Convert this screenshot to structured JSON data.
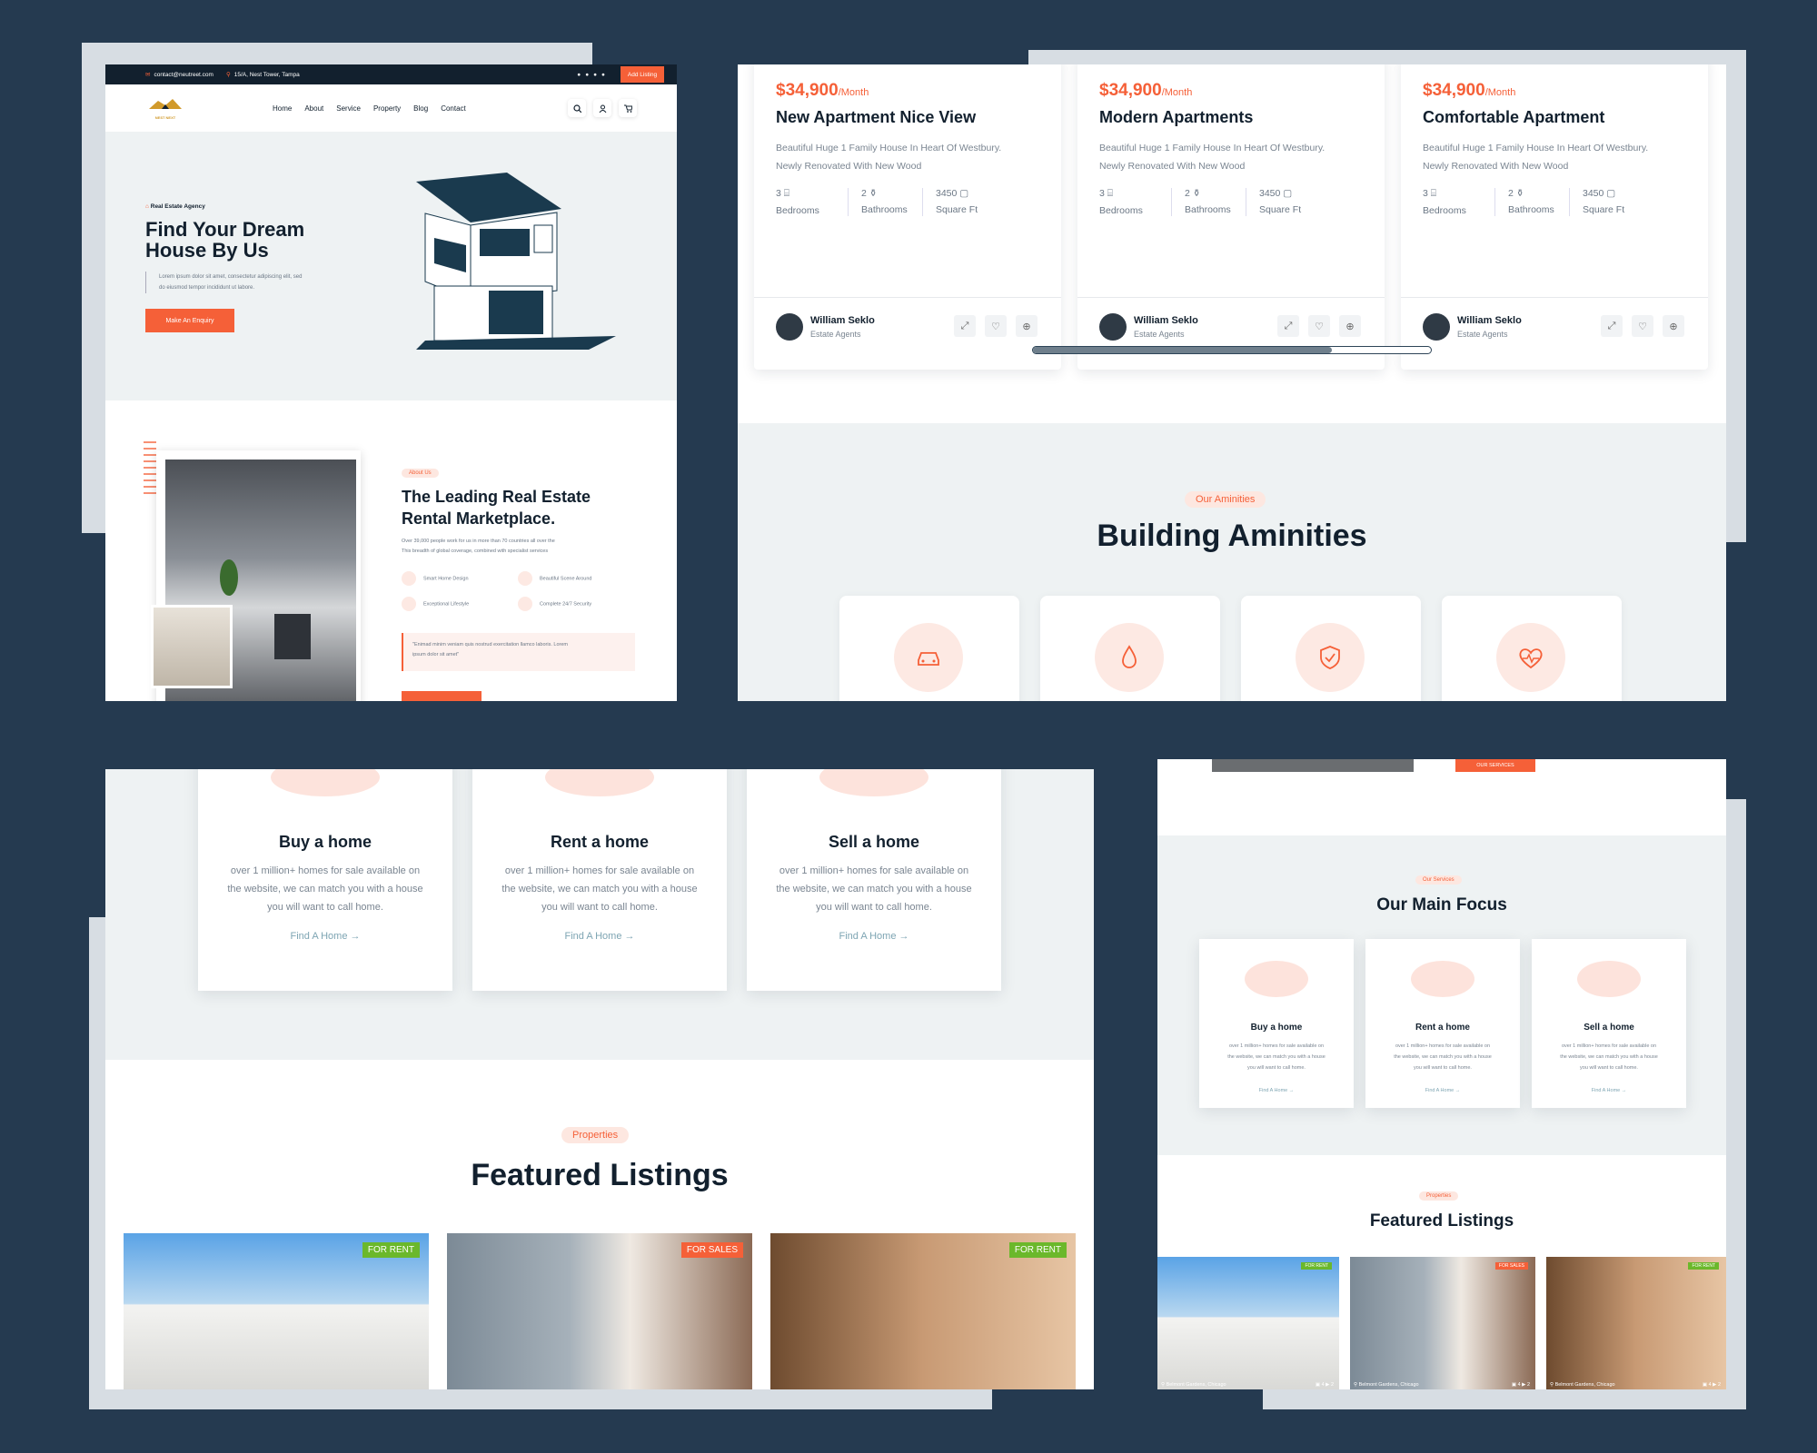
{
  "panelA": {
    "topbar": {
      "email": "contact@neutreet.com",
      "address": "15/A, Nest Tower, Tampa",
      "add_listing": "Add Listing"
    },
    "logo_text": "NEST NEXT",
    "nav": [
      "Home",
      "About",
      "Service",
      "Property",
      "Blog",
      "Contact"
    ],
    "hero": {
      "tag": "Real Estate Agency",
      "title1": "Find Your Dream",
      "title2": "House By Us",
      "desc1": "Lorem ipsum dolor sit amet, consectetur adipiscing elit, sed",
      "desc2": "do eiusmod tempor incididunt ut labore.",
      "cta": "Make An Enquiry"
    },
    "about": {
      "pill": "About Us",
      "title1": "The Leading Real Estate",
      "title2": "Rental Marketplace.",
      "desc1": "Over 39,000 people work for us in more than 70 countries all over the",
      "desc2": "This breadth of global coverage, combined with specialist services",
      "features": [
        "Smart Home Design",
        "Beautiful Scene Around",
        "Exceptional Lifestyle",
        "Complete 24/7 Security"
      ],
      "quote1": "\"Enimad minim veniam quis nostrud exercitation llamco laboris. Lorem",
      "quote2": "ipsum dolor sit amet\""
    }
  },
  "panelB": {
    "cards": [
      {
        "price": "$34,900",
        "period": "/Month",
        "title": "New Apartment Nice View"
      },
      {
        "price": "$34,900",
        "period": "/Month",
        "title": "Modern Apartments"
      },
      {
        "price": "$34,900",
        "period": "/Month",
        "title": "Comfortable Apartment"
      }
    ],
    "card_desc1": "Beautiful Huge 1 Family House In Heart Of Westbury.",
    "card_desc2": "Newly Renovated With New Wood",
    "stats": [
      {
        "value": "3",
        "label": "Bedrooms"
      },
      {
        "value": "2",
        "label": "Bathrooms"
      },
      {
        "value": "3450",
        "label": "Square Ft"
      }
    ],
    "agent": {
      "name": "William Seklo",
      "role": "Estate Agents"
    },
    "carousel_progress": 0.75,
    "amenities_pill": "Our Aminities",
    "amenities_title": "Building Aminities",
    "amenity_icons": [
      "car-icon",
      "water-drop-icon",
      "shield-check-icon",
      "heart-pulse-icon"
    ]
  },
  "panelC": {
    "services": [
      {
        "title": "Buy a home",
        "link": "Find A Home"
      },
      {
        "title": "Rent a home",
        "link": "Find A Home"
      },
      {
        "title": "Sell a home",
        "link": "Find A Home"
      }
    ],
    "service_desc1": "over 1 million+ homes for sale available on",
    "service_desc2": "the website, we can match you with a house",
    "service_desc3": "you will want to call home.",
    "listings_pill": "Properties",
    "listings_title": "Featured Listings",
    "listing_tags": [
      "FOR RENT",
      "FOR SALES",
      "FOR RENT"
    ]
  },
  "panelD": {
    "top_button": "OUR SERVICES",
    "pill": "Our Services",
    "title": "Our Main Focus",
    "services": [
      {
        "title": "Buy a home",
        "link": "Find A Home"
      },
      {
        "title": "Rent a home",
        "link": "Find A Home"
      },
      {
        "title": "Sell a home",
        "link": "Find A Home"
      }
    ],
    "service_desc1": "over 1 million+ homes for sale available on",
    "service_desc2": "the website, we can match you with a house",
    "service_desc3": "you will want to call home.",
    "listings_pill": "Properties",
    "listings_title": "Featured Listings",
    "listing_tags": [
      "FOR RENT",
      "FOR SALES",
      "FOR RENT"
    ],
    "location": "Belmont Gardens, Chicago",
    "photo_count": "4",
    "video_count": "2"
  },
  "colors": {
    "background": "#253a50",
    "accent": "#f56038",
    "dark": "#12202e",
    "rent_tag": "#6bb82b",
    "light_bg": "#eef2f3"
  }
}
